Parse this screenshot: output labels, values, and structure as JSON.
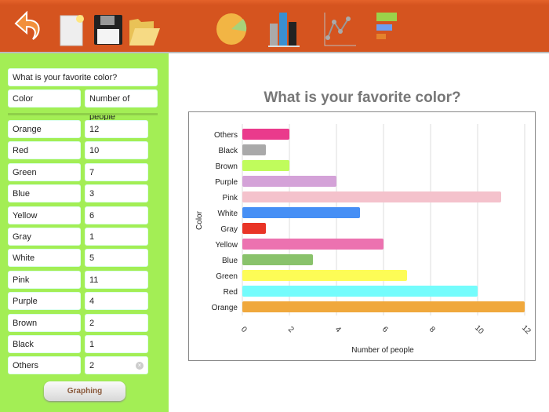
{
  "toolbar": {
    "icons": [
      "undo-icon",
      "new-document-icon",
      "save-icon",
      "open-folder-icon",
      "pie-chart-icon",
      "bar-chart-icon",
      "line-chart-icon",
      "horizontal-bar-chart-icon"
    ]
  },
  "form": {
    "question": "What is your favorite color?",
    "col1_header": "Color",
    "col2_header": "Number of people",
    "rows": [
      {
        "label": "Orange",
        "value": "12"
      },
      {
        "label": "Red",
        "value": "10"
      },
      {
        "label": "Green",
        "value": "7"
      },
      {
        "label": "Blue",
        "value": "3"
      },
      {
        "label": "Yellow",
        "value": "6"
      },
      {
        "label": "Gray",
        "value": "1"
      },
      {
        "label": "White",
        "value": "5"
      },
      {
        "label": "Pink",
        "value": "11"
      },
      {
        "label": "Purple",
        "value": "4"
      },
      {
        "label": "Brown",
        "value": "2"
      },
      {
        "label": "Black",
        "value": "1"
      },
      {
        "label": "Others",
        "value": "2"
      }
    ],
    "button": "Graphing"
  },
  "chart_data": {
    "type": "bar",
    "orientation": "horizontal",
    "title": "What is your favorite color?",
    "xlabel": "Number of people",
    "ylabel": "Color",
    "categories": [
      "Orange",
      "Red",
      "Green",
      "Blue",
      "Yellow",
      "Gray",
      "White",
      "Pink",
      "Purple",
      "Brown",
      "Black",
      "Others"
    ],
    "values": [
      12,
      10,
      7,
      3,
      6,
      1,
      5,
      11,
      4,
      2,
      1,
      2
    ],
    "colors": [
      "#f0a83c",
      "#74fcfc",
      "#fdfc56",
      "#89c26b",
      "#ec72b0",
      "#e93426",
      "#468ff5",
      "#f4c2cc",
      "#d4a2d8",
      "#c0fc5c",
      "#a9a9a9",
      "#ea3a8c"
    ],
    "xlim": [
      0,
      12
    ],
    "xticks": [
      "0",
      "2",
      "4",
      "6",
      "8",
      "10",
      "12"
    ],
    "grid": true
  }
}
